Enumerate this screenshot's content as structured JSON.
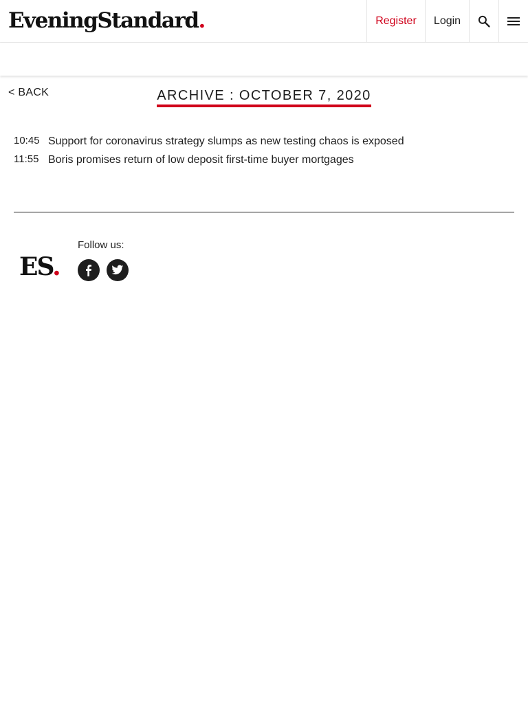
{
  "header": {
    "logo_text": "EveningStandard",
    "logo_dot": ".",
    "register_label": "Register",
    "login_label": "Login",
    "search_icon": "search-icon",
    "menu_icon": "hamburger-menu-icon"
  },
  "nav": {
    "back_label": "< BACK"
  },
  "archive": {
    "title": "ARCHIVE : OCTOBER 7, 2020",
    "items": [
      {
        "time": "10:45",
        "headline": "Support for coronavirus strategy slumps as new testing chaos is exposed"
      },
      {
        "time": "11:55",
        "headline": "Boris promises return of low deposit first-time buyer mortgages"
      }
    ]
  },
  "footer": {
    "logo_text": "ES",
    "logo_dot": ".",
    "follow_label": "Follow us:",
    "social": [
      "facebook-icon",
      "twitter-icon"
    ]
  },
  "colors": {
    "accent": "#d0021b",
    "text": "#1e1e1e"
  }
}
